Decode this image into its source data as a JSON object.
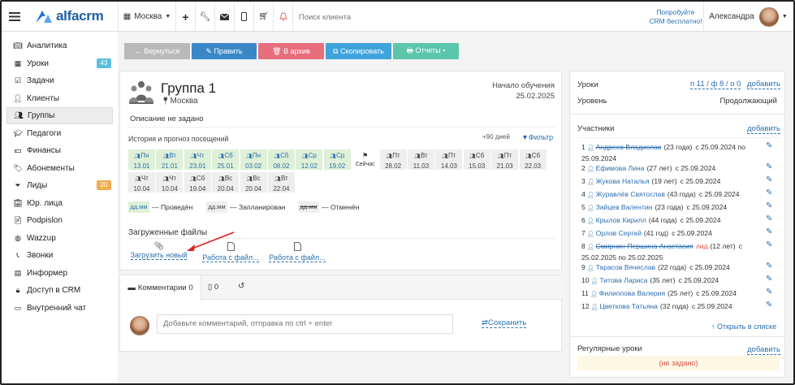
{
  "topbar": {
    "logo": "alfacrm",
    "branch": "Москва",
    "search_placeholder": "Поиск клиента",
    "promo_line1": "Попробуйте",
    "promo_line2": "CRM бесплатно!",
    "user_name": "Александра"
  },
  "sidebar": {
    "items": [
      {
        "label": "Аналитика",
        "icon": "book-icon"
      },
      {
        "label": "Уроки",
        "icon": "calendar-icon",
        "badge": "43",
        "badge_color": "#5bc0de"
      },
      {
        "label": "Задачи",
        "icon": "task-icon"
      },
      {
        "label": "Клиенты",
        "icon": "user-icon"
      },
      {
        "label": "Группы",
        "icon": "users-icon",
        "active": true
      },
      {
        "label": "Педагоги",
        "icon": "graduation-cap-icon"
      },
      {
        "label": "Финансы",
        "icon": "money-icon"
      },
      {
        "label": "Абонементы",
        "icon": "tag-icon"
      },
      {
        "label": "Лиды",
        "icon": "funnel-icon",
        "badge": "20",
        "badge_color": "#f0ad4e"
      },
      {
        "label": "Юр. лица",
        "icon": "building-icon"
      },
      {
        "label": "Podpislon",
        "icon": "document-icon"
      },
      {
        "label": "Wazzup",
        "icon": "whatsapp-icon"
      },
      {
        "label": "Звонки",
        "icon": "phone-icon"
      },
      {
        "label": "Информер",
        "icon": "informer-icon"
      },
      {
        "label": "Доступ в CRM",
        "icon": "lock-icon"
      },
      {
        "label": "Внутренний чат",
        "icon": "chat-icon"
      }
    ]
  },
  "actions": {
    "back": "← Вернуться",
    "edit": "✎ Править",
    "archive": "🗑 В архив",
    "copy": "⧉ Скопировать",
    "reports": "🖶 Отчеты ▾"
  },
  "group": {
    "title": "Группа 1",
    "location": "Москва",
    "start_label": "Начало обучения",
    "start_date": "25.02.2025",
    "description": "Описание не задано",
    "history_label": "История и прогноз посещений",
    "forecast_label": "+90 дней",
    "filter_label": "Фильтр"
  },
  "visits": [
    {
      "day": "Пн",
      "date": "13.01",
      "type": "done"
    },
    {
      "day": "Вт",
      "date": "21.01",
      "type": "done"
    },
    {
      "day": "Чт",
      "date": "23.01",
      "type": "done"
    },
    {
      "day": "Сб",
      "date": "25.01",
      "type": "done"
    },
    {
      "day": "Пн",
      "date": "03.02",
      "type": "done"
    },
    {
      "day": "Сб",
      "date": "08.02",
      "type": "done"
    },
    {
      "day": "Ср",
      "date": "12.02",
      "type": "done"
    },
    {
      "day": "Ср",
      "date": "19.02",
      "type": "done"
    },
    {
      "day": "",
      "date": "Сейчас",
      "type": "now"
    },
    {
      "day": "Пт",
      "date": "28.02",
      "type": "plan"
    },
    {
      "day": "Вт",
      "date": "11.03",
      "type": "plan"
    },
    {
      "day": "Пт",
      "date": "14.03",
      "type": "plan"
    },
    {
      "day": "Сб",
      "date": "15.03",
      "type": "plan"
    },
    {
      "day": "Пт",
      "date": "21.03",
      "type": "plan"
    },
    {
      "day": "Сб",
      "date": "22.03",
      "type": "plan"
    },
    {
      "day": "Чт",
      "date": "10.04",
      "type": "plan"
    },
    {
      "day": "Чт",
      "date": "10.04",
      "type": "plan"
    },
    {
      "day": "Сб",
      "date": "19.04",
      "type": "plan"
    },
    {
      "day": "Вс",
      "date": "20.04",
      "type": "plan"
    },
    {
      "day": "Вс",
      "date": "20.04",
      "type": "plan"
    },
    {
      "day": "Вт",
      "date": "22.04",
      "type": "plan"
    }
  ],
  "legend": {
    "sample": "дд.мм",
    "done": "— Проведён",
    "planned": "— Запланирован",
    "cancelled": "— Отменён"
  },
  "files": {
    "title": "Загруженные файлы",
    "upload": "Загрузить новый",
    "work1": "Работа с файл...",
    "work2": "Работа с файл..."
  },
  "comments": {
    "tab_label": "Комментарии 0",
    "tab2_count": "0",
    "placeholder": "Добавьте комментарий, отправка по ctrl + enter",
    "save": "Сохранить"
  },
  "lessons": {
    "label": "Уроки",
    "value": "п 11 / ф 8 / о 0",
    "add": "добавить",
    "level_label": "Уровень",
    "level_value": "Продолжающий"
  },
  "participants": {
    "label": "Участники",
    "add": "добавить",
    "open": "Открыть в списке",
    "members": [
      {
        "n": "1",
        "name": "Андреев Владислав",
        "info": "(23 года)",
        "since": "с 25.09.2024 по",
        "line2": "25.09.2024",
        "struck": true
      },
      {
        "n": "2",
        "name": "Ефимова Лина",
        "info": "(27 лет)",
        "since": "с 25.09.2024"
      },
      {
        "n": "3",
        "name": "Жукова Наталья",
        "info": "(19 лет)",
        "since": "с 25.09.2024"
      },
      {
        "n": "4",
        "name": "Журавлёв Святослав",
        "info": "(43 года)",
        "since": "с 25.09.2024"
      },
      {
        "n": "5",
        "name": "Зайцев Валентин",
        "info": "(23 года)",
        "since": "с 25.09.2024"
      },
      {
        "n": "6",
        "name": "Крылов Кирилл",
        "info": "(44 года)",
        "since": "с 25.09.2024"
      },
      {
        "n": "7",
        "name": "Орлов Сергей",
        "info": "(41 год)",
        "since": "с 25.09.2024"
      },
      {
        "n": "8",
        "name": "Смирнин-Першина Анастасия",
        "lead": "лид",
        "info": "(12 лет)",
        "since": "с",
        "line2": "25.02.2025 по 25.02.2025",
        "struck": true
      },
      {
        "n": "9",
        "name": "Тарасов Вячеслав",
        "info": "(22 года)",
        "since": "с 25.09.2024"
      },
      {
        "n": "10",
        "name": "Титова Лариса",
        "info": "(35 лет)",
        "since": "с 25.09.2024"
      },
      {
        "n": "11",
        "name": "Филиппова Валерия",
        "info": "(25 лет)",
        "since": "с 25.09.2024"
      },
      {
        "n": "12",
        "name": "Цветкова Татьяна",
        "info": "(32 года)",
        "since": "с 25.09.2024"
      }
    ]
  },
  "regular": {
    "label": "Регулярные уроки",
    "add": "добавить",
    "empty": "(не задано)"
  }
}
